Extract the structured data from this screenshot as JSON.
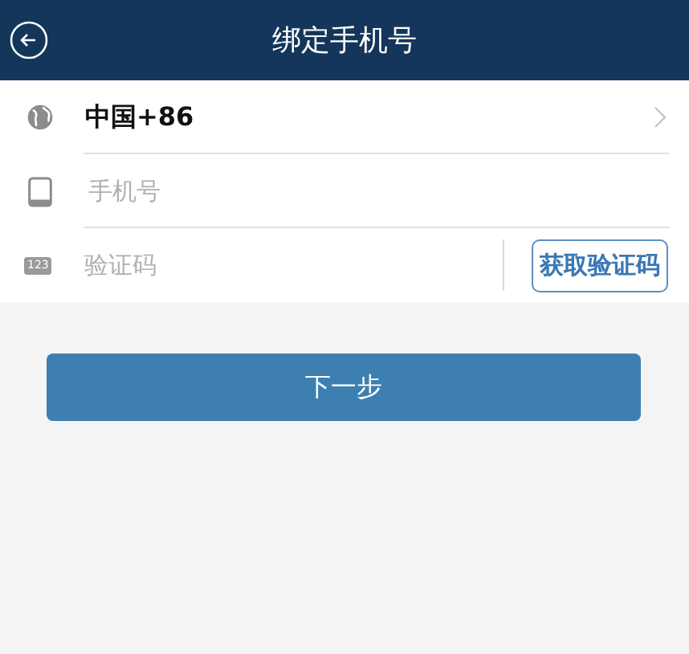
{
  "header": {
    "title": "绑定手机号"
  },
  "region": {
    "value": "中国+86"
  },
  "phone": {
    "placeholder": "手机号"
  },
  "code": {
    "placeholder": "验证码",
    "icon_text": "123",
    "button": "获取验证码"
  },
  "next_button": "下一步"
}
